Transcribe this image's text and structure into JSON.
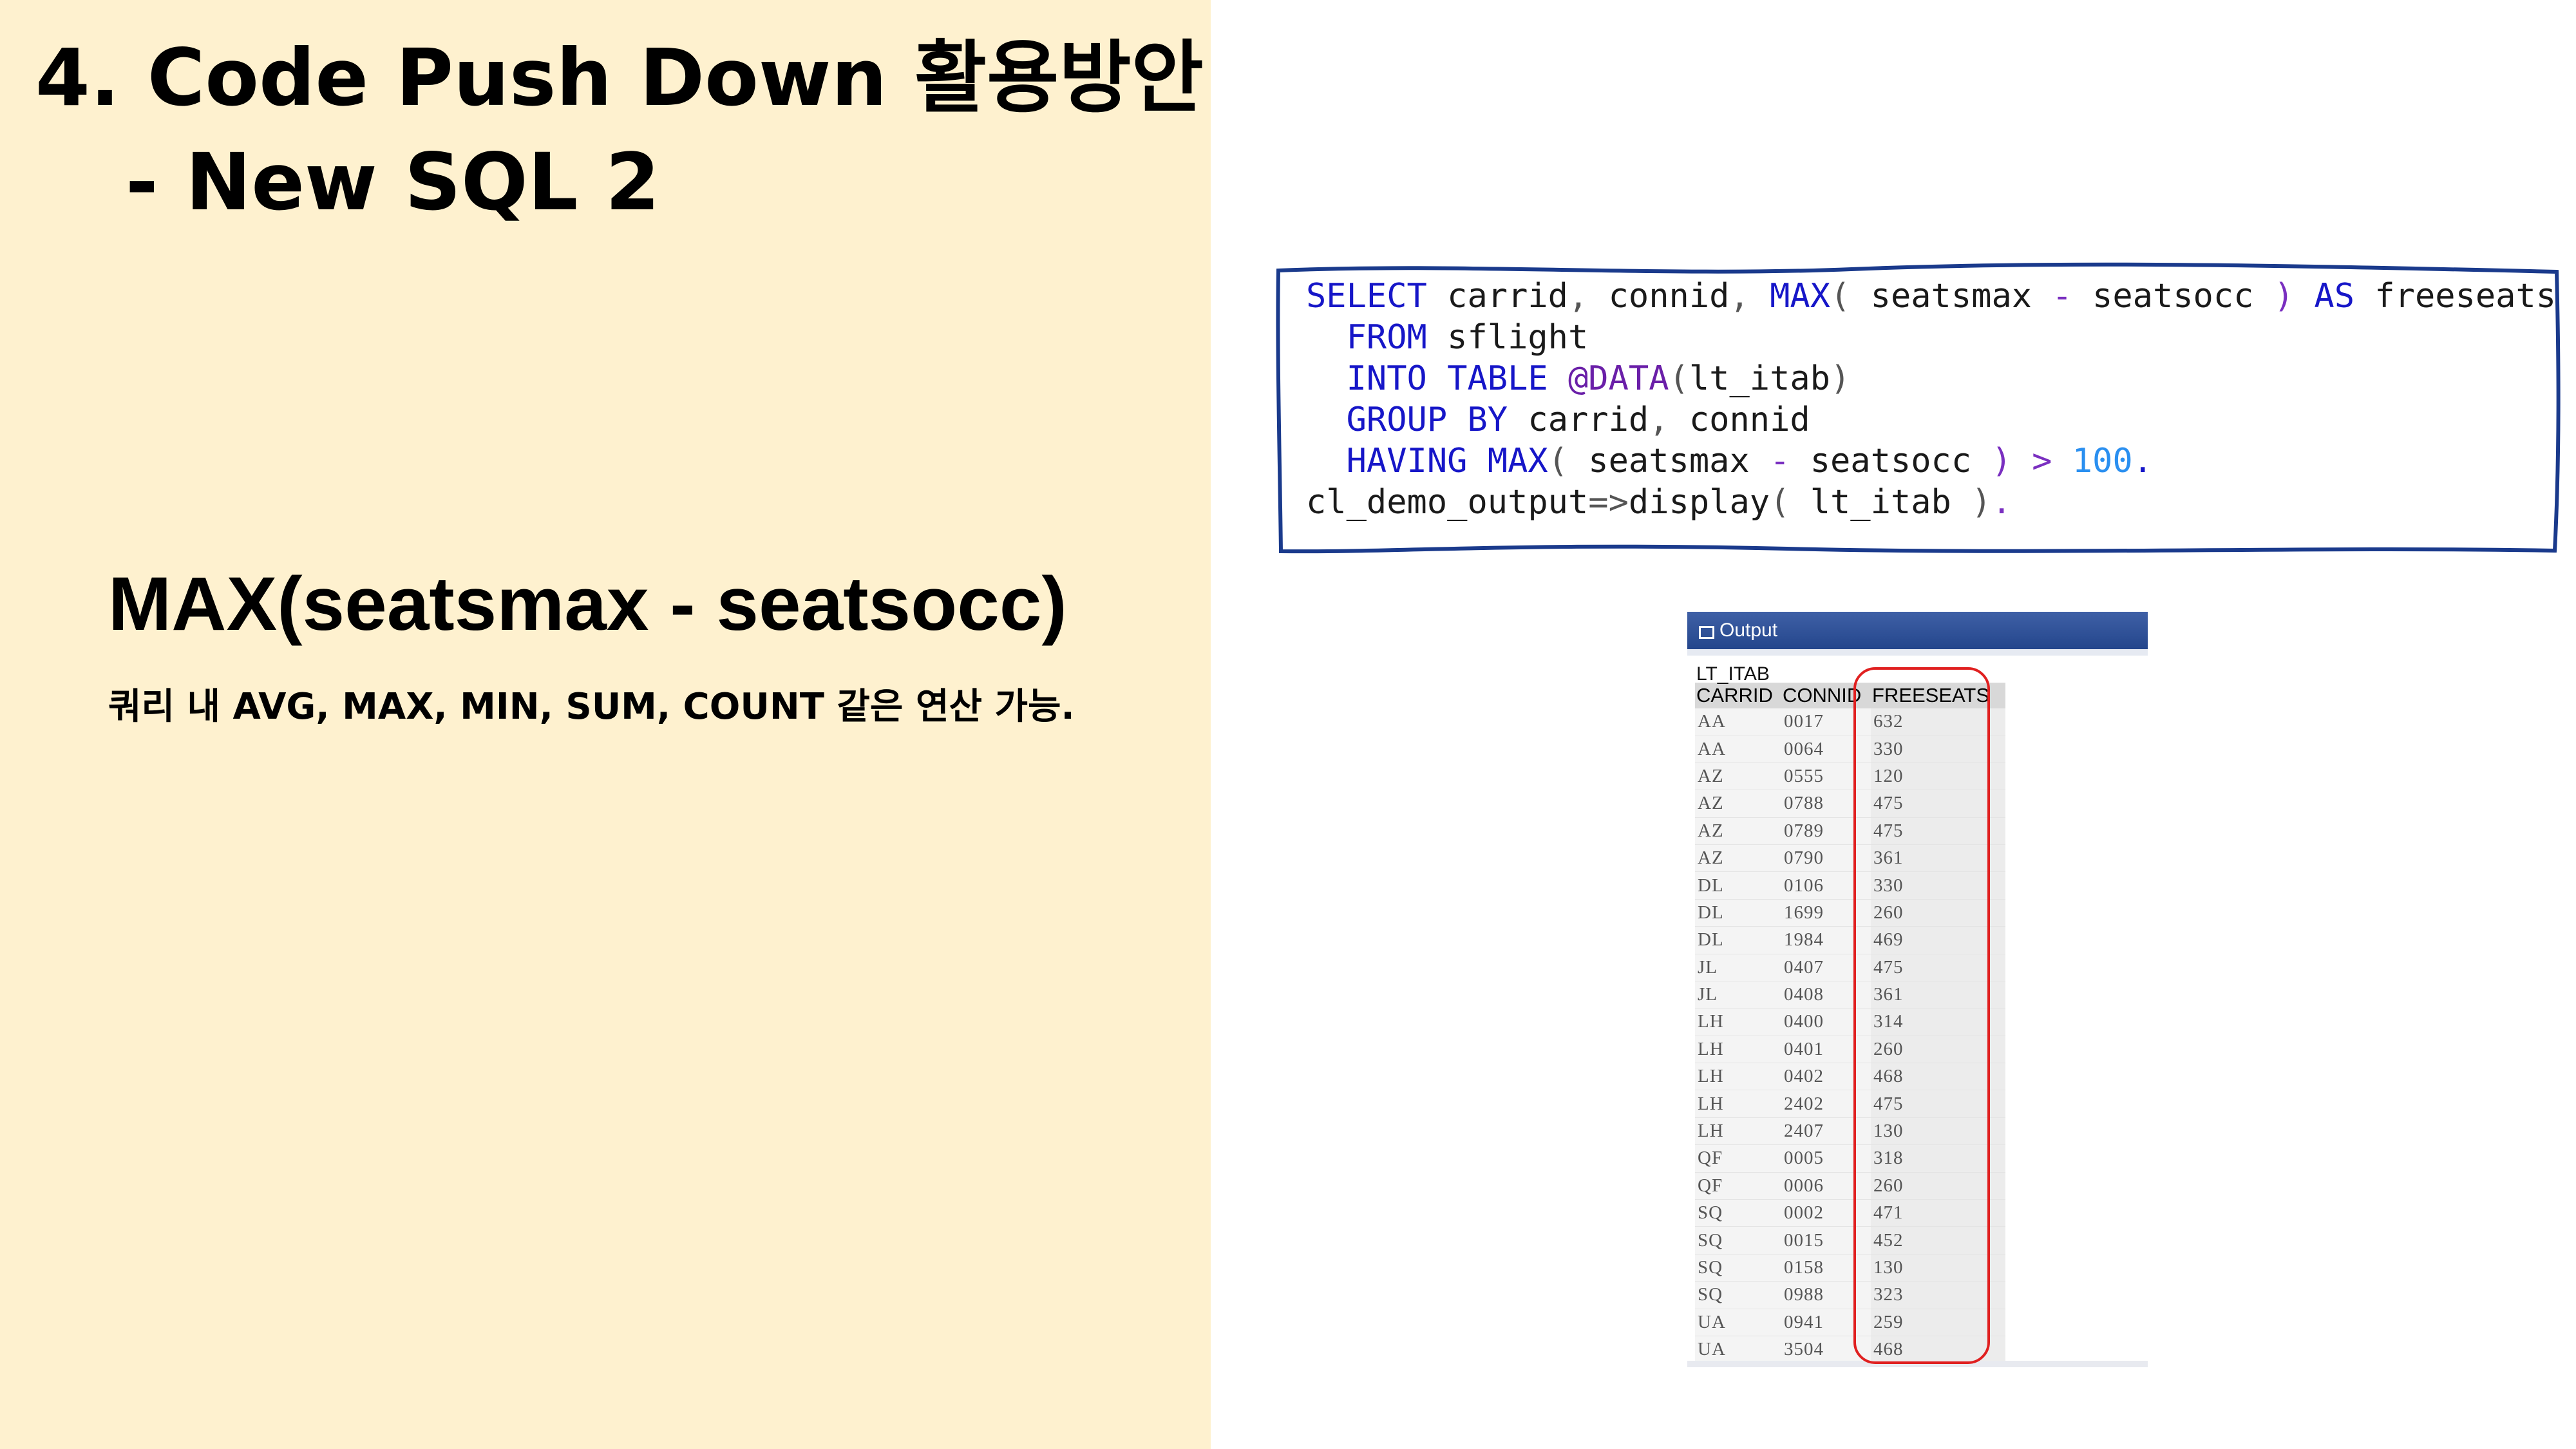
{
  "title": {
    "line1": "4. Code Push Down 활용방안",
    "line2": "- New SQL 2"
  },
  "heading": "MAX(seatsmax - seatsocc)",
  "subtext": "쿼리 내 AVG, MAX, MIN, SUM, COUNT 같은 연산 가능.",
  "code": {
    "l1_kw1": "SELECT",
    "l1_t1": " carrid",
    "l1_p1": ",",
    "l1_t2": " connid",
    "l1_p2": ",",
    "l1_fn": " MAX",
    "l1_p3": "(",
    "l1_t3": " seatsmax ",
    "l1_op": "-",
    "l1_t4": " seatsocc ",
    "l1_p4": ")",
    "l1_kw2": " AS",
    "l1_t5": " freeseats",
    "l2_kw": "  FROM",
    "l2_t": " sflight",
    "l3_kw": "  INTO TABLE",
    "l3_fn": " @DATA",
    "l3_p1": "(",
    "l3_t": "lt_itab",
    "l3_p2": ")",
    "l4_kw": "  GROUP BY",
    "l4_t1": " carrid",
    "l4_p": ",",
    "l4_t2": " connid",
    "l5_kw": "  HAVING",
    "l5_fn": " MAX",
    "l5_p1": "(",
    "l5_t1": " seatsmax ",
    "l5_op": "-",
    "l5_t2": " seatsocc ",
    "l5_p2": ")",
    "l5_op2": " >",
    "l5_num": " 100",
    "l5_dot": ".",
    "l6_t1": "cl_demo_output",
    "l6_op": "=>",
    "l6_t2": "display",
    "l6_p1": "(",
    "l6_t3": " lt_itab ",
    "l6_p2": ")",
    "l6_dot": "."
  },
  "output": {
    "window_title": "Output",
    "icon": "output-window-icon",
    "table_name": "LT_ITAB",
    "columns": [
      "CARRID",
      "CONNID",
      "FREESEATS"
    ],
    "rows": [
      [
        "AA",
        "0017",
        "632"
      ],
      [
        "AA",
        "0064",
        "330"
      ],
      [
        "AZ",
        "0555",
        "120"
      ],
      [
        "AZ",
        "0788",
        "475"
      ],
      [
        "AZ",
        "0789",
        "475"
      ],
      [
        "AZ",
        "0790",
        "361"
      ],
      [
        "DL",
        "0106",
        "330"
      ],
      [
        "DL",
        "1699",
        "260"
      ],
      [
        "DL",
        "1984",
        "469"
      ],
      [
        "JL",
        "0407",
        "475"
      ],
      [
        "JL",
        "0408",
        "361"
      ],
      [
        "LH",
        "0400",
        "314"
      ],
      [
        "LH",
        "0401",
        "260"
      ],
      [
        "LH",
        "0402",
        "468"
      ],
      [
        "LH",
        "2402",
        "475"
      ],
      [
        "LH",
        "2407",
        "130"
      ],
      [
        "QF",
        "0005",
        "318"
      ],
      [
        "QF",
        "0006",
        "260"
      ],
      [
        "SQ",
        "0002",
        "471"
      ],
      [
        "SQ",
        "0015",
        "452"
      ],
      [
        "SQ",
        "0158",
        "130"
      ],
      [
        "SQ",
        "0988",
        "323"
      ],
      [
        "UA",
        "0941",
        "259"
      ],
      [
        "UA",
        "3504",
        "468"
      ]
    ]
  },
  "colors": {
    "left_bg": "#fef1cf",
    "keyword": "#1616c8",
    "function": "#6a1fa8",
    "number": "#2a8ff0",
    "highlight": "#e02020",
    "output_bar": "#2f4f98"
  }
}
